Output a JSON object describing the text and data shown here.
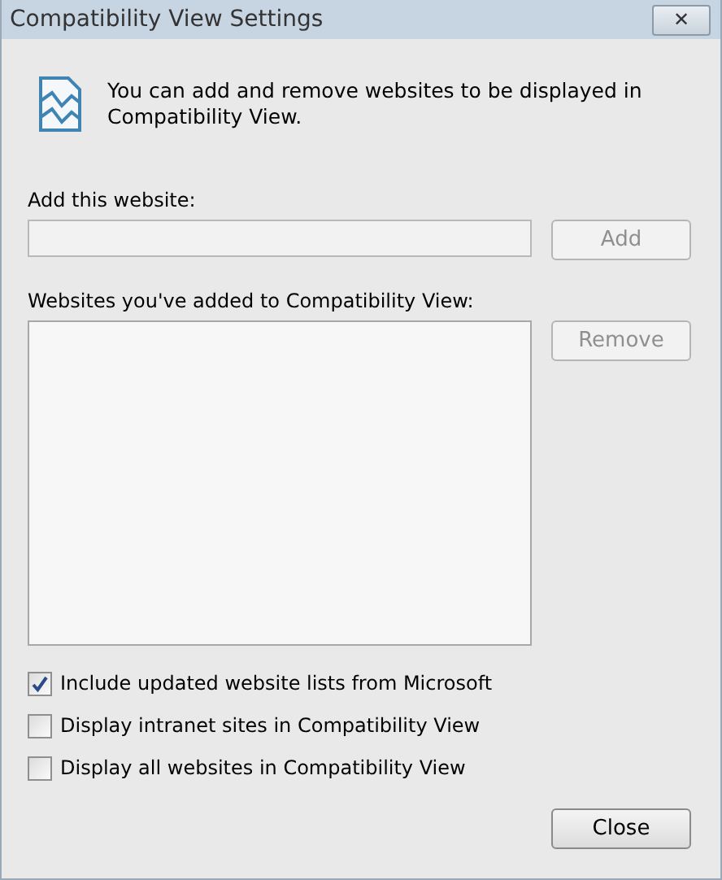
{
  "window": {
    "title": "Compatibility View Settings",
    "close_glyph": "✕"
  },
  "intro": "You can add and remove websites to be displayed in Compatibility View.",
  "add_field": {
    "label": "Add this website:"
  },
  "add_button": {
    "label": "Add",
    "disabled": true
  },
  "list": {
    "label": "Websites you've added to Compatibility View:"
  },
  "remove_button": {
    "label": "Remove",
    "disabled": true
  },
  "options": [
    {
      "label": "Include updated website lists from Microsoft",
      "checked": true
    },
    {
      "label": "Display intranet sites in Compatibility View",
      "checked": false
    },
    {
      "label": "Display all websites in Compatibility View",
      "checked": false
    }
  ],
  "close_button": {
    "label": "Close",
    "disabled": false
  }
}
